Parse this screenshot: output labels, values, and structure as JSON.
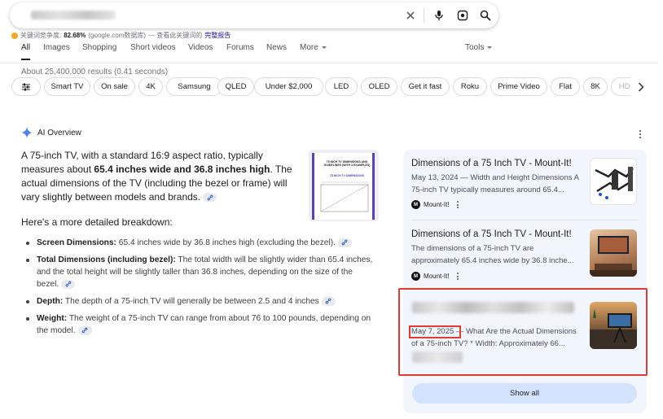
{
  "search": {
    "query_blurred": true
  },
  "seo_bar": {
    "label": "关键词竞争度:",
    "percent": "82.68%",
    "source": "(google.com数据库)",
    "dash_text": "— 查看此关键词的",
    "report_link": "完整报告"
  },
  "tabs": [
    {
      "label": "All",
      "active": true
    },
    {
      "label": "Images"
    },
    {
      "label": "Shopping"
    },
    {
      "label": "Short videos"
    },
    {
      "label": "Videos"
    },
    {
      "label": "Forums"
    },
    {
      "label": "News"
    },
    {
      "label": "More"
    },
    {
      "label": "Tools"
    }
  ],
  "results_count": "About 25,400,000 results (0.41 seconds)",
  "chips": [
    "Smart TV",
    "On sale",
    "4K",
    "Samsung",
    "QLED",
    "Under $2,000",
    "LED",
    "OLED",
    "Get it fast",
    "Roku",
    "Prime Video",
    "Flat",
    "8K",
    "HDR"
  ],
  "ai_overview": {
    "title": "AI Overview",
    "intro_part1": "A 75-inch TV, with a standard 16:9 aspect ratio, typically measures about ",
    "intro_bold": "65.4 inches wide and 36.8 inches high",
    "intro_part2": ". The actual dimensions of the TV (including the bezel or frame) will vary slightly between models and brands.",
    "thumb_title1": "75 INCH TV DIMENSIONS AND GUIDELINES (WITH 3 EXAMPLES)",
    "thumb_title2": "75-INCH TV DIMENSIONS",
    "breakdown_title": "Here's a more detailed breakdown:",
    "bullets": [
      {
        "label": "Screen Dimensions:",
        "text": " 65.4 inches wide by 36.8 inches high (excluding the bezel)."
      },
      {
        "label": "Total Dimensions (including bezel):",
        "text": " The total width will be slightly wider than 65.4 inches, and the total height will be slightly taller than 36.8 inches, depending on the size of the bezel."
      },
      {
        "label": "Depth:",
        "text": " The depth of a 75-inch TV will generally be between 2.5 and 4 inches"
      },
      {
        "label": "Weight:",
        "text": " The weight of a 75-inch TV can range from about 76 to 100 pounds, depending on the model."
      }
    ]
  },
  "sources": [
    {
      "title": "Dimensions of a 75 Inch TV - Mount-It!",
      "snippet": "May 13, 2024 — Width and Height Dimensions A 75-inch TV typically measures around 65.4...",
      "site": "Mount-It!"
    },
    {
      "title": "Dimensions of a 75 Inch TV - Mount-It!",
      "snippet": "The dimensions of a 75-inch TV are approximately 65.4 inches wide by 36.8 inche...",
      "site": "Mount-It!"
    },
    {
      "title_blurred": true,
      "date": "May 7, 2025",
      "snippet": " — What Are the Actual Dimensions of a 75-inch TV? * Width: Approximately 66...",
      "site_blurred": true
    }
  ],
  "show_all": "Show all",
  "colors": {
    "accent": "#1a0dab",
    "panel_bg": "#f1f5fc",
    "highlight": "#e53935",
    "show_all_bg": "#d3e3fd"
  }
}
